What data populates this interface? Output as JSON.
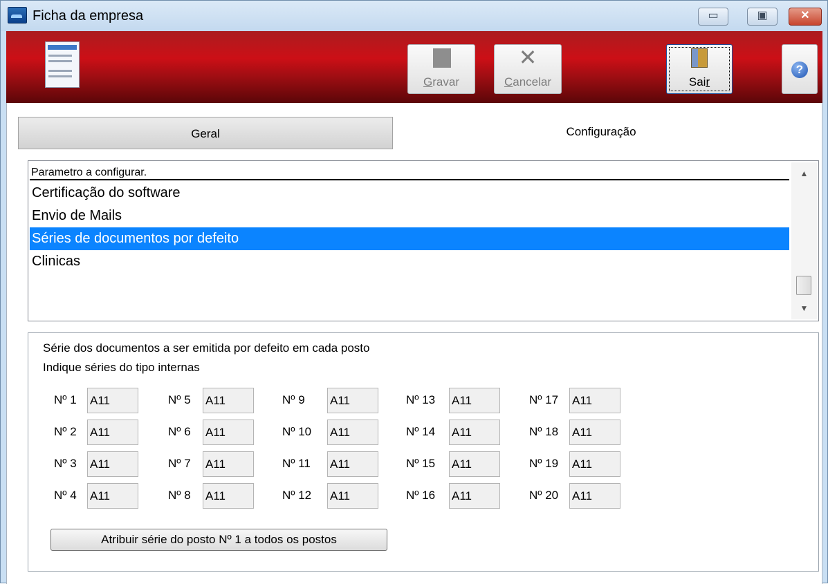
{
  "window": {
    "title": "Ficha da empresa",
    "minimize_glyph": "▭",
    "maximize_glyph": "▣",
    "close_glyph": "✕"
  },
  "toolbar": {
    "gravar": {
      "pre": "",
      "accel": "G",
      "rest": "ravar",
      "icon": "save-icon"
    },
    "cancelar": {
      "pre": "",
      "accel": "C",
      "rest": "ancelar",
      "icon": "close-icon"
    },
    "sair": {
      "pre": "Sai",
      "accel": "r",
      "rest": "",
      "icon": "exit-door-icon"
    },
    "help_glyph": "?",
    "doc_icon": "file-menu-icon"
  },
  "tabs": [
    {
      "label": "Geral",
      "active": false
    },
    {
      "label": "Configuração",
      "active": true
    }
  ],
  "param_list": {
    "header": "Parametro a configurar.",
    "items": [
      "Certificação do software",
      "Envio de Mails",
      "Séries de documentos por defeito",
      "Clinicas"
    ],
    "selected_index": 2,
    "scroll_up_glyph": "▲",
    "scroll_down_glyph": "▼"
  },
  "series_panel": {
    "line1": "Série dos documentos a ser emitida por defeito em cada posto",
    "line2": "Indique séries do tipo internas",
    "postos": [
      {
        "label": "Nº 1",
        "value": "A11"
      },
      {
        "label": "Nº 2",
        "value": "A11"
      },
      {
        "label": "Nº 3",
        "value": "A11"
      },
      {
        "label": "Nº 4",
        "value": "A11"
      },
      {
        "label": "Nº 5",
        "value": "A11"
      },
      {
        "label": "Nº 6",
        "value": "A11"
      },
      {
        "label": "Nº 7",
        "value": "A11"
      },
      {
        "label": "Nº 8",
        "value": "A11"
      },
      {
        "label": "Nº 9",
        "value": "A11"
      },
      {
        "label": "Nº 10",
        "value": "A11"
      },
      {
        "label": "Nº 11",
        "value": "A11"
      },
      {
        "label": "Nº 12",
        "value": "A11"
      },
      {
        "label": "Nº 13",
        "value": "A11"
      },
      {
        "label": "Nº 14",
        "value": "A11"
      },
      {
        "label": "Nº 15",
        "value": "A11"
      },
      {
        "label": "Nº 16",
        "value": "A11"
      },
      {
        "label": "Nº 17",
        "value": "A11"
      },
      {
        "label": "Nº 18",
        "value": "A11"
      },
      {
        "label": "Nº 19",
        "value": "A11"
      },
      {
        "label": "Nº 20",
        "value": "A11"
      }
    ],
    "assign_button": "Atribuir série do posto Nº 1 a todos os postos"
  },
  "colors": {
    "toolbar_red": "#cc0f16",
    "selection_blue": "#0b84ff",
    "titlebar": "#c9dff3"
  }
}
